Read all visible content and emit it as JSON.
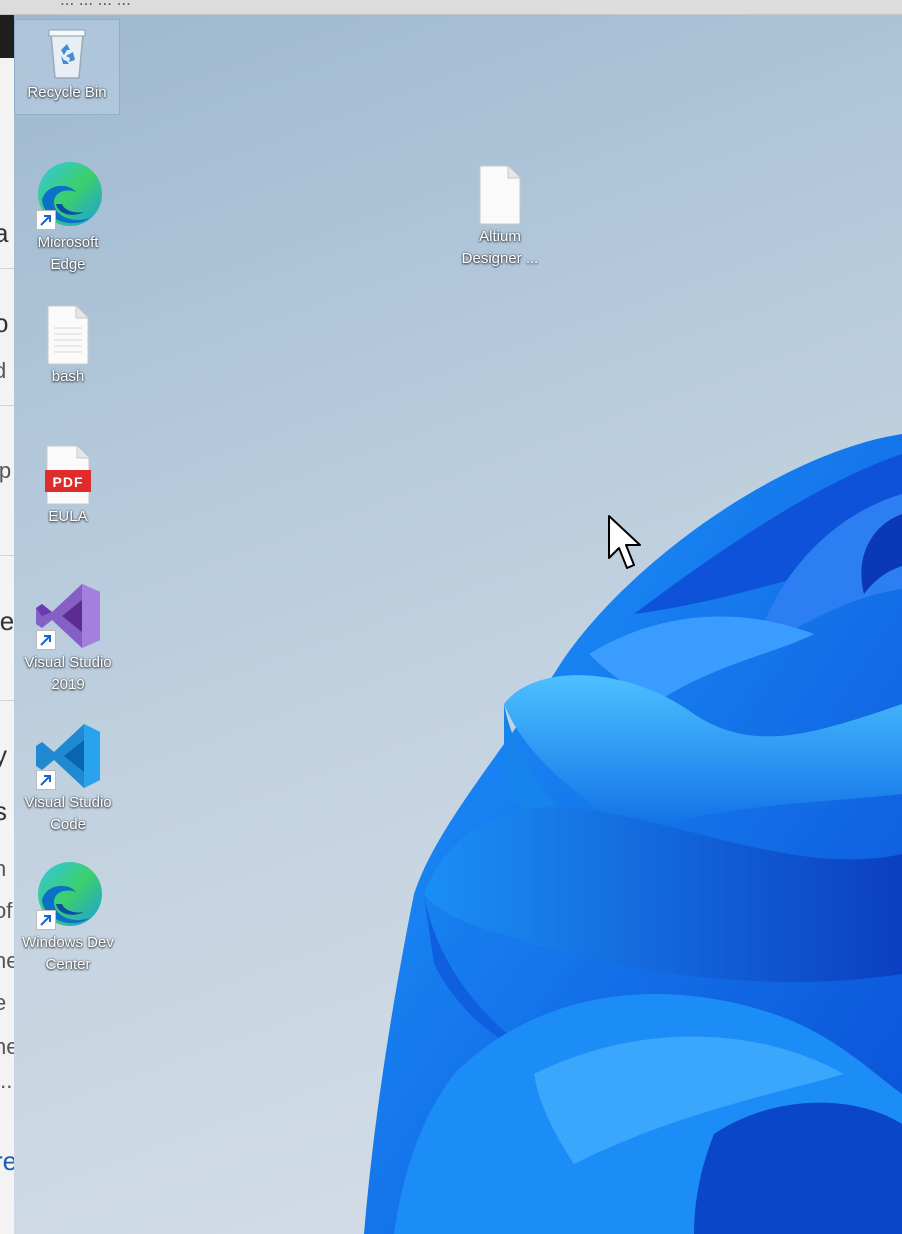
{
  "window": {
    "title_fragment": "...  ...  ...  ...",
    "behind_text": [
      "a",
      "o",
      "d",
      "ip",
      "le",
      "y",
      "s",
      "n",
      "of",
      "ne",
      "e",
      "ne",
      "...",
      "re"
    ]
  },
  "desktop": {
    "icons": [
      {
        "label": "Recycle Bin",
        "icon": "recycle-bin-icon"
      },
      {
        "label": "Microsoft Edge",
        "icon": "edge-icon"
      },
      {
        "label": "bash",
        "icon": "file-icon"
      },
      {
        "label": "EULA",
        "icon": "pdf-icon",
        "badge": "PDF"
      },
      {
        "label": "Visual Studio 2019",
        "icon": "visual-studio-icon"
      },
      {
        "label": "Visual Studio Code",
        "icon": "vscode-icon"
      },
      {
        "label": "Windows Dev Center",
        "icon": "edge-icon"
      },
      {
        "label": "Altium Designer ...",
        "icon": "file-icon"
      }
    ]
  },
  "colors": {
    "edge_green": "#3ccf6a",
    "edge_blue": "#0c6fc8",
    "vs_purple": "#865fc5",
    "vscode_blue": "#1f8ad2",
    "pdf_red": "#e02b2b",
    "bloom_blue": "#1a8cf0"
  }
}
